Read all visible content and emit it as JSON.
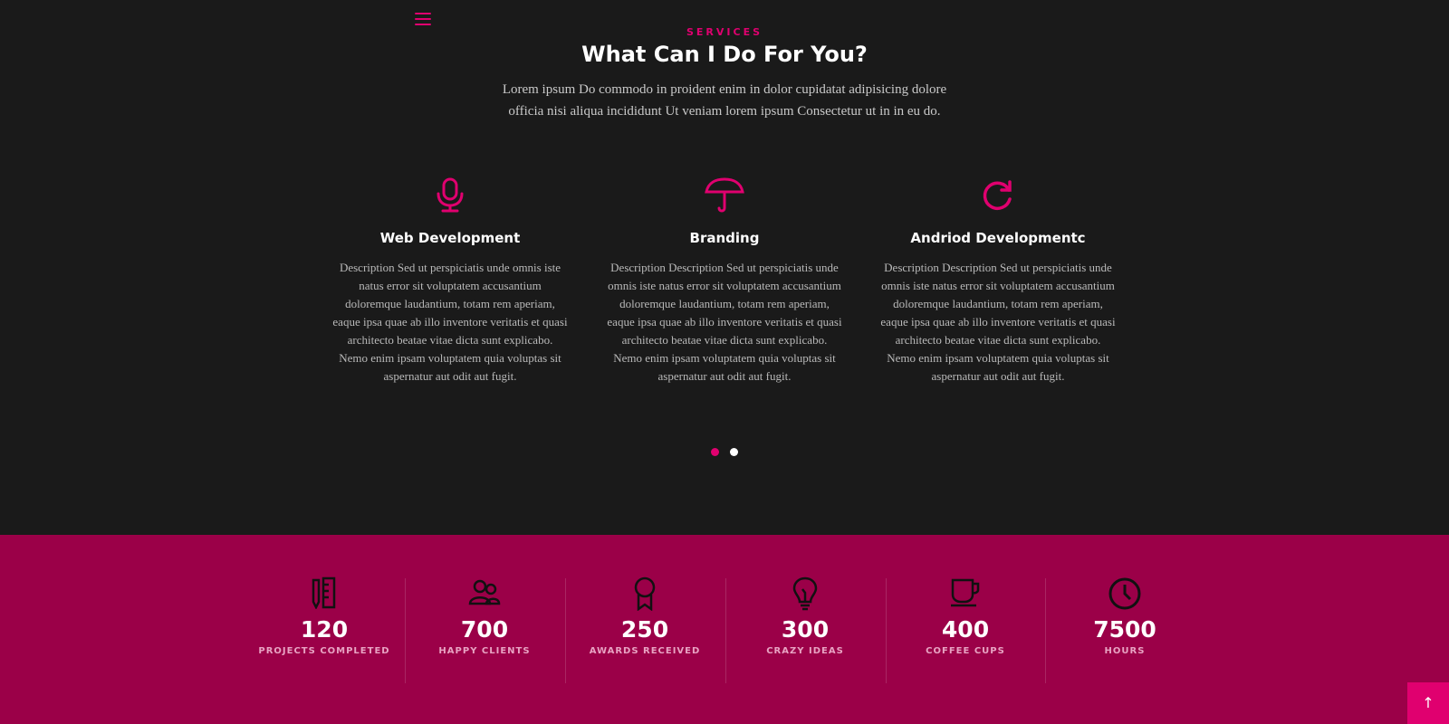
{
  "colors": {
    "accent": "#e0006f",
    "background": "#1a1a1a",
    "band": "#9b0048"
  },
  "nav": {
    "menu_icon": "hamburger-menu-icon"
  },
  "services": {
    "eyebrow": "SERVICES",
    "heading": "What Can I Do For You?",
    "intro": "Lorem ipsum Do commodo in proident enim in dolor cupidatat adipisicing dolore officia nisi aliqua incididunt Ut veniam lorem ipsum Consectetur ut in in eu do.",
    "items": [
      {
        "icon": "microphone-icon",
        "title": "Web Development",
        "description": "Description Sed ut perspiciatis unde omnis iste natus error sit voluptatem accusantium doloremque laudantium, totam rem aperiam, eaque ipsa quae ab illo inventore veritatis et quasi architecto beatae vitae dicta sunt explicabo. Nemo enim ipsam voluptatem quia voluptas sit aspernatur aut odit aut fugit."
      },
      {
        "icon": "umbrella-icon",
        "title": "Branding",
        "description": "Description Description Sed ut perspiciatis unde omnis iste natus error sit voluptatem accusantium doloremque laudantium, totam rem aperiam, eaque ipsa quae ab illo inventore veritatis et quasi architecto beatae vitae dicta sunt explicabo. Nemo enim ipsam voluptatem quia voluptas sit aspernatur aut odit aut fugit."
      },
      {
        "icon": "refresh-icon",
        "title": "Andriod Developmentc",
        "description": "Description Description Sed ut perspiciatis unde omnis iste natus error sit voluptatem accusantium doloremque laudantium, totam rem aperiam, eaque ipsa quae ab illo inventore veritatis et quasi architecto beatae vitae dicta sunt explicabo. Nemo enim ipsam voluptatem quia voluptas sit aspernatur aut odit aut fugit."
      }
    ],
    "carousel": {
      "pages": 2,
      "active": 1
    }
  },
  "counters": [
    {
      "icon": "pencil-ruler-icon",
      "value": "120",
      "label": "PROJECTS COMPLETED"
    },
    {
      "icon": "users-icon",
      "value": "700",
      "label": "HAPPY CLIENTS"
    },
    {
      "icon": "award-icon",
      "value": "250",
      "label": "AWARDS RECEIVED"
    },
    {
      "icon": "lightbulb-icon",
      "value": "300",
      "label": "CRAZY IDEAS"
    },
    {
      "icon": "coffee-cup-icon",
      "value": "400",
      "label": "COFFEE CUPS"
    },
    {
      "icon": "clock-icon",
      "value": "7500",
      "label": "HOURS"
    }
  ],
  "back_to_top": {
    "icon": "arrow-up-icon",
    "glyph": "↑"
  }
}
